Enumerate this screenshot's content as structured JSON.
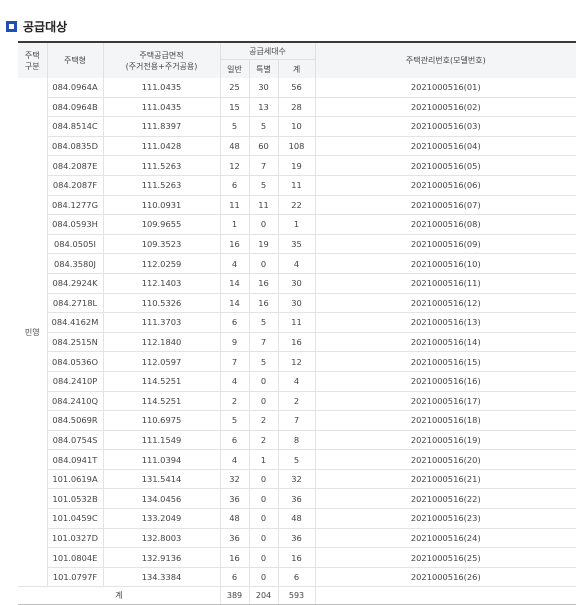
{
  "section": {
    "title": "공급대상"
  },
  "table": {
    "headers": {
      "type": "주택\n구분",
      "model": "주택형",
      "area": "주택공급면적\n(주거전용+주거공용)",
      "units_group": "공급세대수",
      "general": "일반",
      "special": "특별",
      "total": "계",
      "mgmt_no": "주택관리번호(모델번호)"
    },
    "housing_type": "민영",
    "rows": [
      {
        "model": "084.0964A",
        "area": "111.0435",
        "general": "25",
        "special": "30",
        "total": "56",
        "mgmt": "2021000516(01)"
      },
      {
        "model": "084.0964B",
        "area": "111.0435",
        "general": "15",
        "special": "13",
        "total": "28",
        "mgmt": "2021000516(02)"
      },
      {
        "model": "084.8514C",
        "area": "111.8397",
        "general": "5",
        "special": "5",
        "total": "10",
        "mgmt": "2021000516(03)"
      },
      {
        "model": "084.0835D",
        "area": "111.0428",
        "general": "48",
        "special": "60",
        "total": "108",
        "mgmt": "2021000516(04)"
      },
      {
        "model": "084.2087E",
        "area": "111.5263",
        "general": "12",
        "special": "7",
        "total": "19",
        "mgmt": "2021000516(05)"
      },
      {
        "model": "084.2087F",
        "area": "111.5263",
        "general": "6",
        "special": "5",
        "total": "11",
        "mgmt": "2021000516(06)"
      },
      {
        "model": "084.1277G",
        "area": "110.0931",
        "general": "11",
        "special": "11",
        "total": "22",
        "mgmt": "2021000516(07)"
      },
      {
        "model": "084.0593H",
        "area": "109.9655",
        "general": "1",
        "special": "0",
        "total": "1",
        "mgmt": "2021000516(08)"
      },
      {
        "model": "084.0505I",
        "area": "109.3523",
        "general": "16",
        "special": "19",
        "total": "35",
        "mgmt": "2021000516(09)"
      },
      {
        "model": "084.3580J",
        "area": "112.0259",
        "general": "4",
        "special": "0",
        "total": "4",
        "mgmt": "2021000516(10)"
      },
      {
        "model": "084.2924K",
        "area": "112.1403",
        "general": "14",
        "special": "16",
        "total": "30",
        "mgmt": "2021000516(11)"
      },
      {
        "model": "084.2718L",
        "area": "110.5326",
        "general": "14",
        "special": "16",
        "total": "30",
        "mgmt": "2021000516(12)"
      },
      {
        "model": "084.4162M",
        "area": "111.3703",
        "general": "6",
        "special": "5",
        "total": "11",
        "mgmt": "2021000516(13)"
      },
      {
        "model": "084.2515N",
        "area": "112.1840",
        "general": "9",
        "special": "7",
        "total": "16",
        "mgmt": "2021000516(14)"
      },
      {
        "model": "084.0536O",
        "area": "112.0597",
        "general": "7",
        "special": "5",
        "total": "12",
        "mgmt": "2021000516(15)"
      },
      {
        "model": "084.2410P",
        "area": "114.5251",
        "general": "4",
        "special": "0",
        "total": "4",
        "mgmt": "2021000516(16)"
      },
      {
        "model": "084.2410Q",
        "area": "114.5251",
        "general": "2",
        "special": "0",
        "total": "2",
        "mgmt": "2021000516(17)"
      },
      {
        "model": "084.5069R",
        "area": "110.6975",
        "general": "5",
        "special": "2",
        "total": "7",
        "mgmt": "2021000516(18)"
      },
      {
        "model": "084.0754S",
        "area": "111.1549",
        "general": "6",
        "special": "2",
        "total": "8",
        "mgmt": "2021000516(19)"
      },
      {
        "model": "084.0941T",
        "area": "111.0394",
        "general": "4",
        "special": "1",
        "total": "5",
        "mgmt": "2021000516(20)"
      },
      {
        "model": "101.0619A",
        "area": "131.5414",
        "general": "32",
        "special": "0",
        "total": "32",
        "mgmt": "2021000516(21)"
      },
      {
        "model": "101.0532B",
        "area": "134.0456",
        "general": "36",
        "special": "0",
        "total": "36",
        "mgmt": "2021000516(22)"
      },
      {
        "model": "101.0459C",
        "area": "133.2049",
        "general": "48",
        "special": "0",
        "total": "48",
        "mgmt": "2021000516(23)"
      },
      {
        "model": "101.0327D",
        "area": "132.8003",
        "general": "36",
        "special": "0",
        "total": "36",
        "mgmt": "2021000516(24)"
      },
      {
        "model": "101.0804E",
        "area": "132.9136",
        "general": "16",
        "special": "0",
        "total": "16",
        "mgmt": "2021000516(25)"
      },
      {
        "model": "101.0797F",
        "area": "134.3384",
        "general": "6",
        "special": "0",
        "total": "6",
        "mgmt": "2021000516(26)"
      }
    ],
    "totals": {
      "label": "계",
      "general": "389",
      "special": "204",
      "total": "593"
    }
  }
}
